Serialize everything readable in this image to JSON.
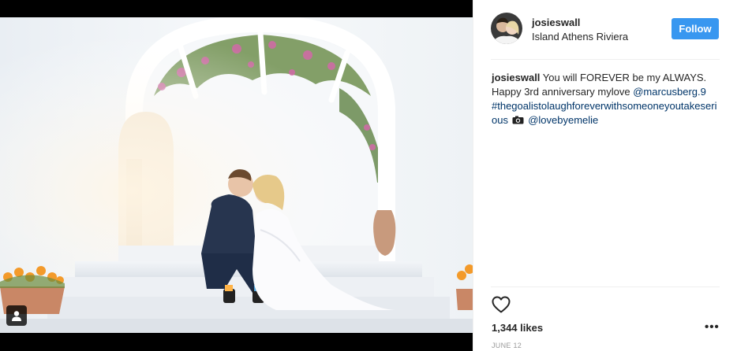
{
  "post": {
    "username": "josieswall",
    "location": "Island Athens Riviera",
    "follow_label": "Follow",
    "caption": {
      "username": "josieswall",
      "text": " You will FOREVER be my ALWAYS. Happy 3rd anniversary mylove ",
      "mention_1": "@marcusberg.9",
      "hashtag": "#thegoalistolaughforeverwithsomeoneyoutakeserious",
      "mention_2": "@lovebyemelie"
    },
    "likes": "1,344 likes",
    "more_label": "•••",
    "date": "JUNE 12"
  },
  "icons": {
    "avatar": "avatar-photo",
    "user_tag": "user-tag-icon",
    "camera": "camera-emoji-icon",
    "heart": "heart-outline-icon",
    "more": "ellipsis-icon"
  },
  "colors": {
    "follow_button": "#3897f0",
    "link": "#003569",
    "date": "#999999",
    "divider": "#efefef"
  }
}
